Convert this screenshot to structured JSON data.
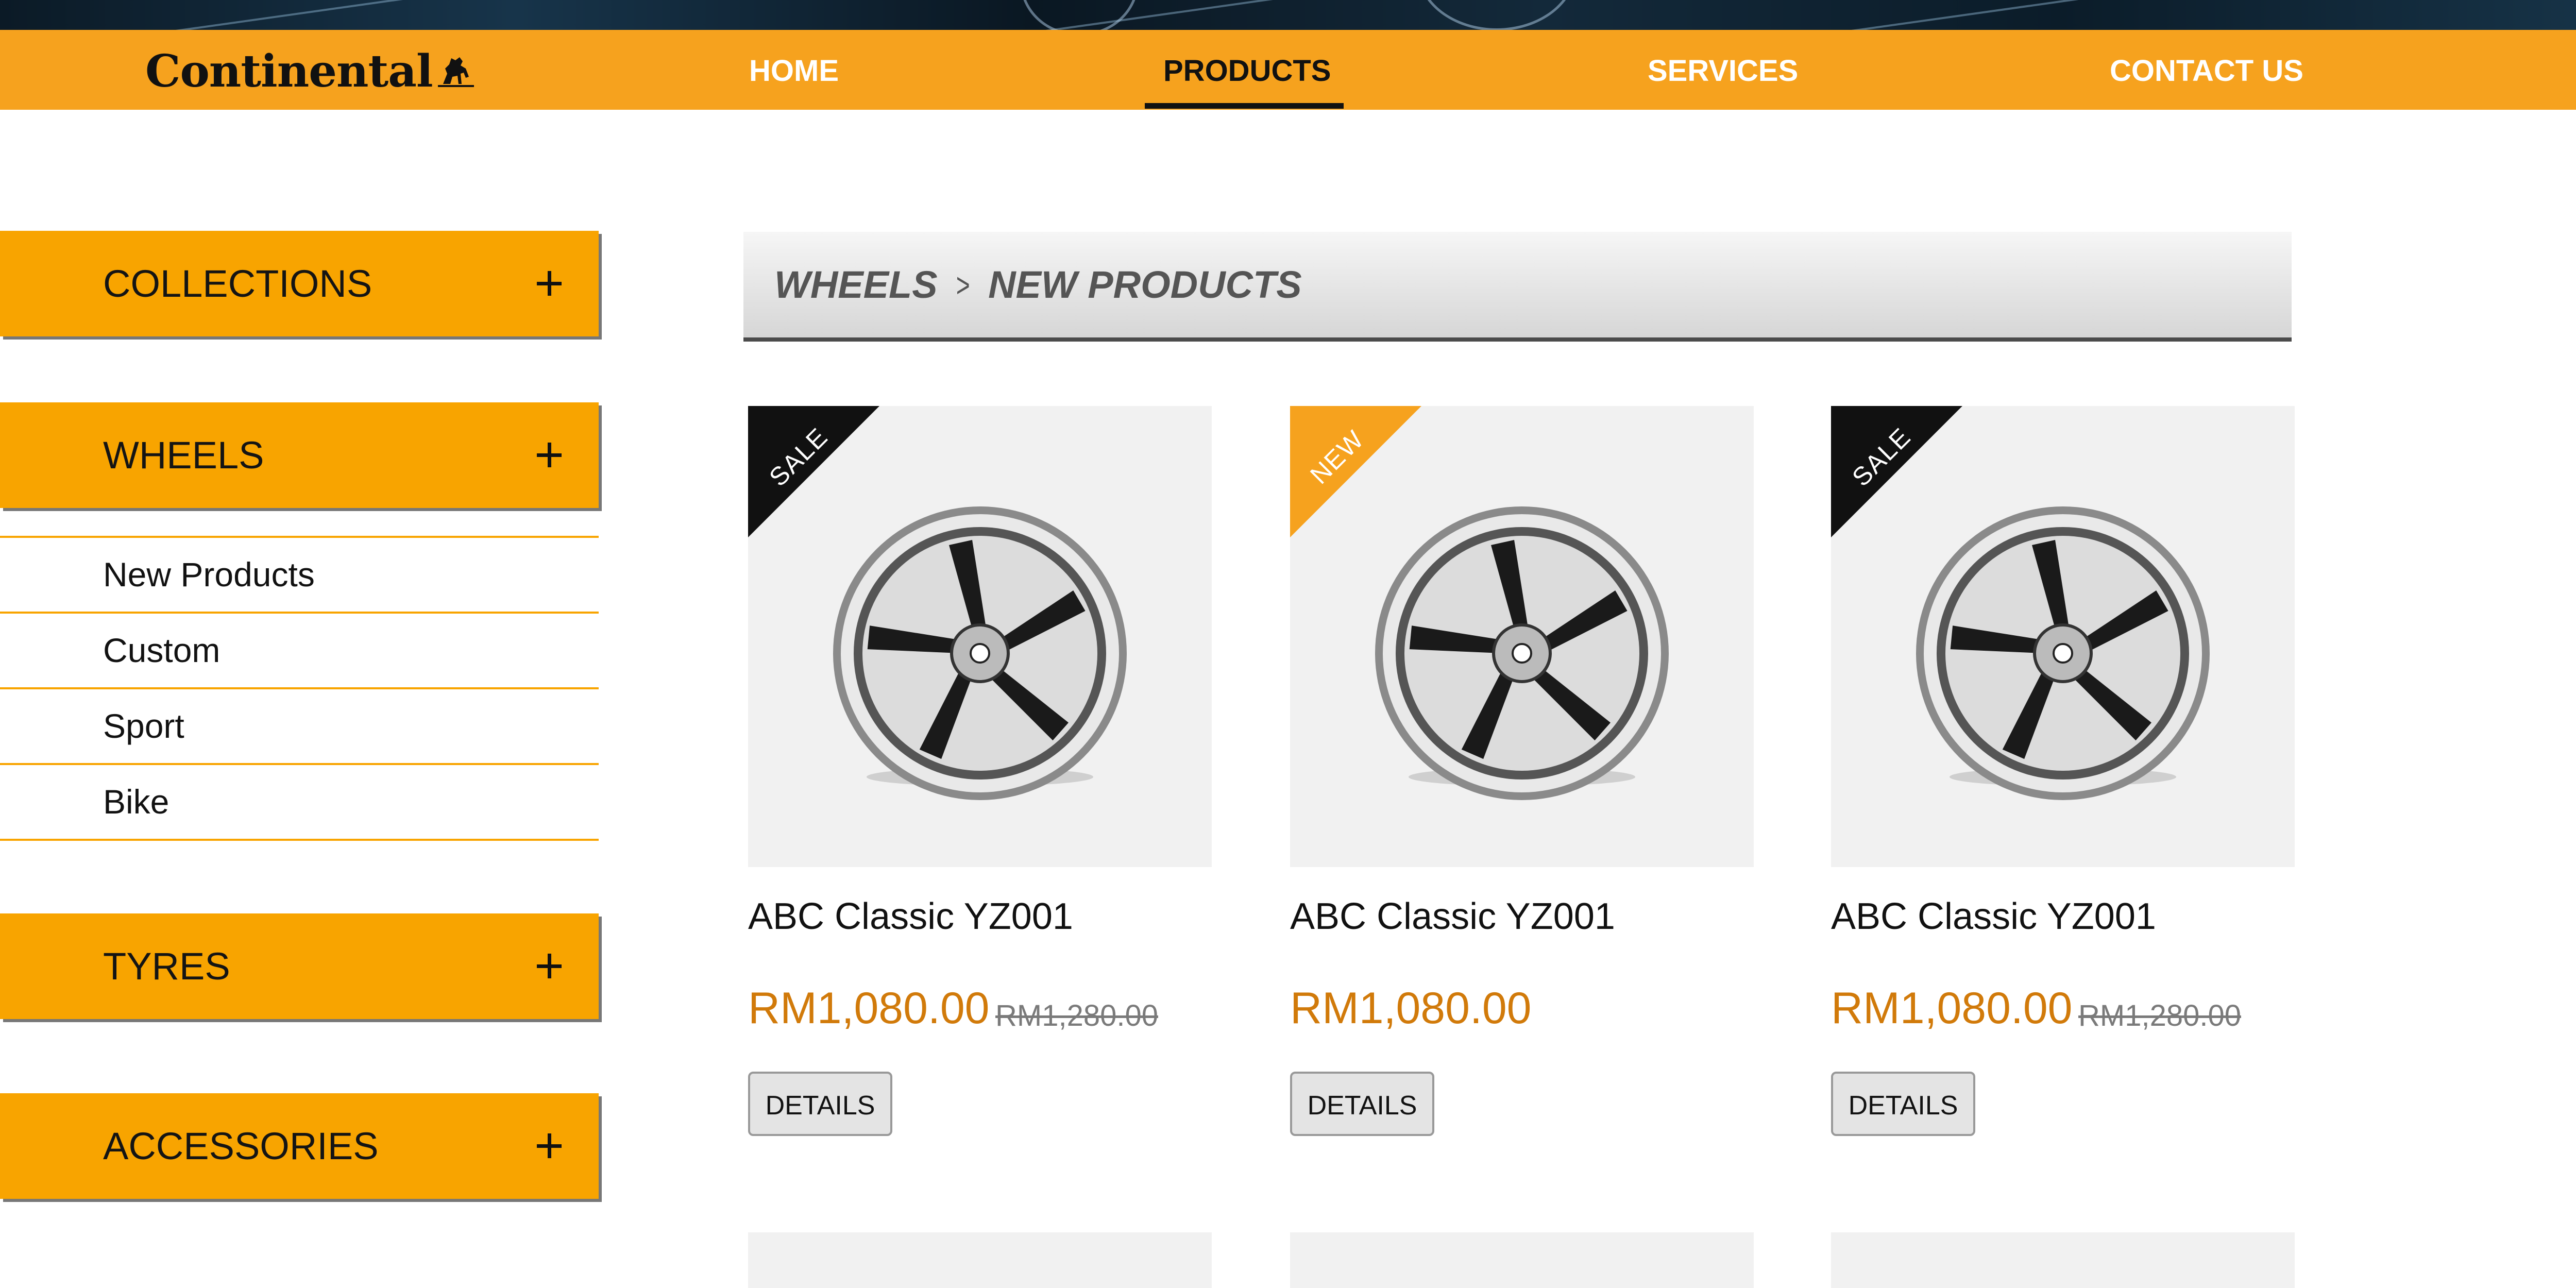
{
  "header": {
    "logo_text": "Continental",
    "nav": {
      "home": "HOME",
      "products": "PRODUCTS",
      "services": "SERVICES",
      "contact": "CONTACT US",
      "active": "products"
    }
  },
  "sidebar": {
    "sections": [
      {
        "label": "COLLECTIONS",
        "icon": "plus-icon"
      },
      {
        "label": "WHEELS",
        "icon": "plus-icon"
      },
      {
        "label": "TYRES",
        "icon": "plus-icon"
      },
      {
        "label": "ACCESSORIES",
        "icon": "plus-icon"
      }
    ],
    "wheels_items": [
      "New Products",
      "Custom",
      "Sport",
      "Bike"
    ]
  },
  "breadcrumb": {
    "items": [
      "WHEELS",
      "NEW PRODUCTS"
    ],
    "separator": ">"
  },
  "products": [
    {
      "badge": "SALE",
      "name": "ABC Classic YZ001",
      "price": "RM1,080.00",
      "old_price": "RM1,280.00",
      "button": "DETAILS"
    },
    {
      "badge": "NEW",
      "name": "ABC Classic YZ001",
      "price": "RM1,080.00",
      "old_price": "",
      "button": "DETAILS"
    },
    {
      "badge": "SALE",
      "name": "ABC Classic YZ001",
      "price": "RM1,080.00",
      "old_price": "RM1,280.00",
      "button": "DETAILS"
    }
  ],
  "colors": {
    "brand_orange": "#f6a21e",
    "sidebar_orange": "#f8a400",
    "price_orange": "#d17a0a",
    "sale_badge": "#111111"
  }
}
